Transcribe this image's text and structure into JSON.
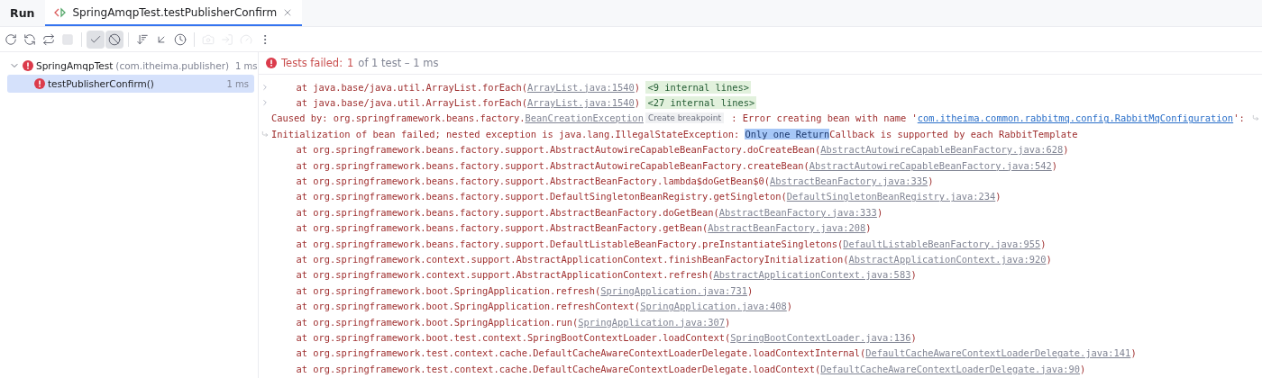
{
  "tool_window": {
    "title": "Run"
  },
  "tabs": [
    {
      "label": "SpringAmqpTest.testPublisherConfirm",
      "selected": true
    }
  ],
  "toolbar": [
    {
      "kind": "rerun",
      "disabled": false,
      "pressed": false
    },
    {
      "kind": "rerun-failed",
      "disabled": false,
      "pressed": false
    },
    {
      "kind": "rerun-auto",
      "disabled": false,
      "pressed": false
    },
    {
      "kind": "stop",
      "disabled": true,
      "pressed": false
    },
    {
      "kind": "sep"
    },
    {
      "kind": "show-passed",
      "disabled": false,
      "pressed": true
    },
    {
      "kind": "show-ignored",
      "disabled": false,
      "pressed": true
    },
    {
      "kind": "sep"
    },
    {
      "kind": "sort",
      "disabled": false,
      "pressed": false
    },
    {
      "kind": "collapse",
      "disabled": false,
      "pressed": false
    },
    {
      "kind": "history",
      "disabled": false,
      "pressed": false
    },
    {
      "kind": "sep"
    },
    {
      "kind": "camera",
      "disabled": true,
      "pressed": false
    },
    {
      "kind": "import",
      "disabled": true,
      "pressed": false
    },
    {
      "kind": "gauge",
      "disabled": true,
      "pressed": false
    },
    {
      "kind": "more",
      "disabled": false,
      "pressed": false
    }
  ],
  "tree": [
    {
      "name": "SpringAmqpTest",
      "package": "(com.itheima.publisher)",
      "time": "1 ms",
      "expanded": true,
      "selected": false,
      "children": [
        {
          "name": "testPublisherConfirm()",
          "time": "1 ms",
          "selected": true
        }
      ]
    }
  ],
  "summary": {
    "label": "Tests failed:",
    "failed": "1",
    "rest": "of 1 test – 1 ms"
  },
  "console": [
    {
      "kind": "frame",
      "marker": {
        "kind": "fold"
      },
      "segments": [
        {
          "kind": "text",
          "text": "at java.base/java.util.ArrayList.forEach("
        },
        {
          "kind": "link",
          "text": "ArrayList.java:1540"
        },
        {
          "kind": "text",
          "text": ")"
        },
        {
          "kind": "folded",
          "text": "<9 internal lines>"
        }
      ]
    },
    {
      "kind": "frame",
      "marker": {
        "kind": "fold"
      },
      "segments": [
        {
          "kind": "text",
          "text": "at java.base/java.util.ArrayList.forEach("
        },
        {
          "kind": "link",
          "text": "ArrayList.java:1540"
        },
        {
          "kind": "text",
          "text": ")"
        },
        {
          "kind": "folded",
          "text": "<27 internal lines>"
        }
      ]
    },
    {
      "kind": "message",
      "marker": {
        "kind": "wrap-end"
      },
      "segments": [
        {
          "kind": "text",
          "text": "Caused by: org.springframework.beans.factory."
        },
        {
          "kind": "link",
          "text": "BeanCreationException"
        },
        {
          "kind": "hint",
          "text": "Create breakpoint"
        },
        {
          "kind": "text",
          "text": " : Error creating bean with name '"
        },
        {
          "kind": "link-blue",
          "text": "com.itheima.common.rabbitmq.config.RabbitMqConfiguration"
        },
        {
          "kind": "text",
          "text": "':"
        }
      ]
    },
    {
      "kind": "message",
      "marker": {
        "kind": "wrap-start"
      },
      "segments": [
        {
          "kind": "text",
          "text": "Initialization of bean failed; nested exception is java.lang.IllegalStateException: "
        },
        {
          "kind": "highlight",
          "text": "Only one Return"
        },
        {
          "kind": "text",
          "text": "Callback is supported by each RabbitTemplate"
        }
      ]
    },
    {
      "kind": "frame",
      "segments": [
        {
          "kind": "text",
          "text": "at org.springframework.beans.factory.support.AbstractAutowireCapableBeanFactory.doCreateBean("
        },
        {
          "kind": "link",
          "text": "AbstractAutowireCapableBeanFactory.java:628"
        },
        {
          "kind": "text",
          "text": ")"
        }
      ]
    },
    {
      "kind": "frame",
      "segments": [
        {
          "kind": "text",
          "text": "at org.springframework.beans.factory.support.AbstractAutowireCapableBeanFactory.createBean("
        },
        {
          "kind": "link",
          "text": "AbstractAutowireCapableBeanFactory.java:542"
        },
        {
          "kind": "text",
          "text": ")"
        }
      ]
    },
    {
      "kind": "frame",
      "segments": [
        {
          "kind": "text",
          "text": "at org.springframework.beans.factory.support.AbstractBeanFactory.lambda$doGetBean$0("
        },
        {
          "kind": "link",
          "text": "AbstractBeanFactory.java:335"
        },
        {
          "kind": "text",
          "text": ")"
        }
      ]
    },
    {
      "kind": "frame",
      "segments": [
        {
          "kind": "text",
          "text": "at org.springframework.beans.factory.support.DefaultSingletonBeanRegistry.getSingleton("
        },
        {
          "kind": "link",
          "text": "DefaultSingletonBeanRegistry.java:234"
        },
        {
          "kind": "text",
          "text": ")"
        }
      ]
    },
    {
      "kind": "frame",
      "segments": [
        {
          "kind": "text",
          "text": "at org.springframework.beans.factory.support.AbstractBeanFactory.doGetBean("
        },
        {
          "kind": "link",
          "text": "AbstractBeanFactory.java:333"
        },
        {
          "kind": "text",
          "text": ")"
        }
      ]
    },
    {
      "kind": "frame",
      "segments": [
        {
          "kind": "text",
          "text": "at org.springframework.beans.factory.support.AbstractBeanFactory.getBean("
        },
        {
          "kind": "link",
          "text": "AbstractBeanFactory.java:208"
        },
        {
          "kind": "text",
          "text": ")"
        }
      ]
    },
    {
      "kind": "frame",
      "segments": [
        {
          "kind": "text",
          "text": "at org.springframework.beans.factory.support.DefaultListableBeanFactory.preInstantiateSingletons("
        },
        {
          "kind": "link",
          "text": "DefaultListableBeanFactory.java:955"
        },
        {
          "kind": "text",
          "text": ")"
        }
      ]
    },
    {
      "kind": "frame",
      "segments": [
        {
          "kind": "text",
          "text": "at org.springframework.context.support.AbstractApplicationContext.finishBeanFactoryInitialization("
        },
        {
          "kind": "link",
          "text": "AbstractApplicationContext.java:920"
        },
        {
          "kind": "text",
          "text": ")"
        }
      ]
    },
    {
      "kind": "frame",
      "segments": [
        {
          "kind": "text",
          "text": "at org.springframework.context.support.AbstractApplicationContext.refresh("
        },
        {
          "kind": "link",
          "text": "AbstractApplicationContext.java:583"
        },
        {
          "kind": "text",
          "text": ")"
        }
      ]
    },
    {
      "kind": "frame",
      "segments": [
        {
          "kind": "text",
          "text": "at org.springframework.boot.SpringApplication.refresh("
        },
        {
          "kind": "link",
          "text": "SpringApplication.java:731"
        },
        {
          "kind": "text",
          "text": ")"
        }
      ]
    },
    {
      "kind": "frame",
      "segments": [
        {
          "kind": "text",
          "text": "at org.springframework.boot.SpringApplication.refreshContext("
        },
        {
          "kind": "link",
          "text": "SpringApplication.java:408"
        },
        {
          "kind": "text",
          "text": ")"
        }
      ]
    },
    {
      "kind": "frame",
      "segments": [
        {
          "kind": "text",
          "text": "at org.springframework.boot.SpringApplication.run("
        },
        {
          "kind": "link",
          "text": "SpringApplication.java:307"
        },
        {
          "kind": "text",
          "text": ")"
        }
      ]
    },
    {
      "kind": "frame",
      "segments": [
        {
          "kind": "text",
          "text": "at org.springframework.boot.test.context.SpringBootContextLoader.loadContext("
        },
        {
          "kind": "link",
          "text": "SpringBootContextLoader.java:136"
        },
        {
          "kind": "text",
          "text": ")"
        }
      ]
    },
    {
      "kind": "frame",
      "segments": [
        {
          "kind": "text",
          "text": "at org.springframework.test.context.cache.DefaultCacheAwareContextLoaderDelegate.loadContextInternal("
        },
        {
          "kind": "link",
          "text": "DefaultCacheAwareContextLoaderDelegate.java:141"
        },
        {
          "kind": "text",
          "text": ")"
        }
      ]
    },
    {
      "kind": "frame",
      "segments": [
        {
          "kind": "text",
          "text": "at org.springframework.test.context.cache.DefaultCacheAwareContextLoaderDelegate.loadContext("
        },
        {
          "kind": "link",
          "text": "DefaultCacheAwareContextLoaderDelegate.java:90"
        },
        {
          "kind": "text",
          "text": ")"
        }
      ]
    }
  ]
}
